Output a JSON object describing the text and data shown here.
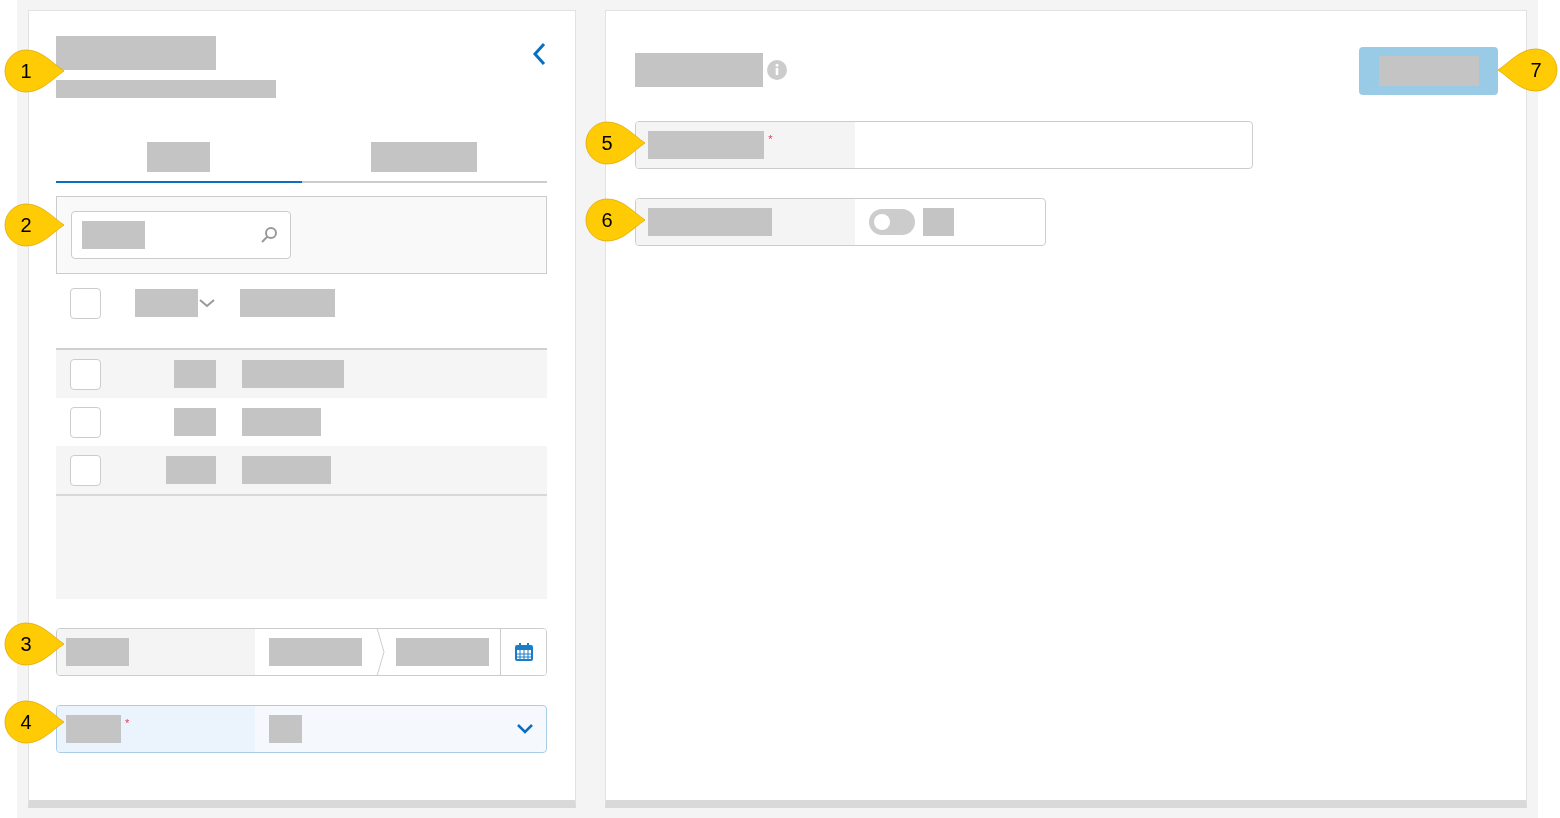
{
  "left_panel": {
    "tabs": [
      {
        "selected": true
      },
      {
        "selected": false
      }
    ],
    "table": {
      "header_checkbox": {
        "checked": false
      },
      "rows": [
        {
          "checked": false
        },
        {
          "checked": false
        },
        {
          "checked": false
        }
      ]
    },
    "select_field": {
      "required_marker": "*"
    }
  },
  "right_panel": {
    "name_field": {
      "required_marker": "*"
    },
    "toggle_field": {
      "on": false
    }
  },
  "callouts": [
    "1",
    "2",
    "3",
    "4",
    "5",
    "6",
    "7"
  ]
}
